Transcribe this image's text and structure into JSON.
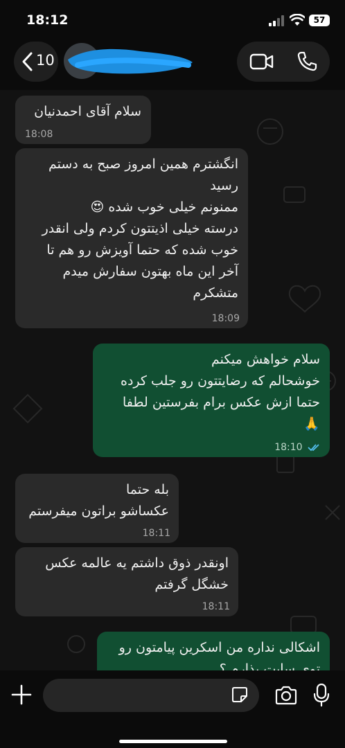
{
  "status_bar": {
    "time": "18:12",
    "battery": "57"
  },
  "header": {
    "back_count": "10"
  },
  "messages": [
    {
      "dir": "in",
      "lines": [
        "سلام آقای احمدنیان"
      ],
      "time": "18:08"
    },
    {
      "dir": "in",
      "lines": [
        "انگشترم همین امروز صبح به دستم",
        "رسید",
        "ممنونم خیلی خوب شده 😍",
        "درسته خیلی اذیتتون کردم ولی انقدر",
        "خوب شده که حتما آویزش رو هم تا",
        "آخر این ماه بهتون سفارش میدم",
        "متشکرم"
      ],
      "time": "18:09"
    },
    {
      "dir": "out",
      "lines": [
        "سلام خواهش میکنم",
        "خوشحالم که رضایتتون رو جلب کرده",
        "حتما ازش عکس برام بفرستین لطفا",
        "🙏"
      ],
      "time": "18:10",
      "read": true
    },
    {
      "dir": "in",
      "lines": [
        "بله حتما",
        "عکساشو براتون میفرستم"
      ],
      "time": "18:11"
    },
    {
      "dir": "in",
      "lines": [
        "اونقدر ذوق داشتم یه عالمه عکس",
        "خشگل گرفتم"
      ],
      "time": "18:11"
    },
    {
      "dir": "out",
      "lines": [
        "اشکالی نداره من اسکرین پیامتون رو",
        "توی سایت بذارم ؟"
      ],
      "time": ""
    }
  ],
  "composer": {
    "value": ""
  },
  "colors": {
    "incoming": "#2a2a2a",
    "outgoing": "#114f32",
    "read_ticks": "#53bdeb"
  }
}
